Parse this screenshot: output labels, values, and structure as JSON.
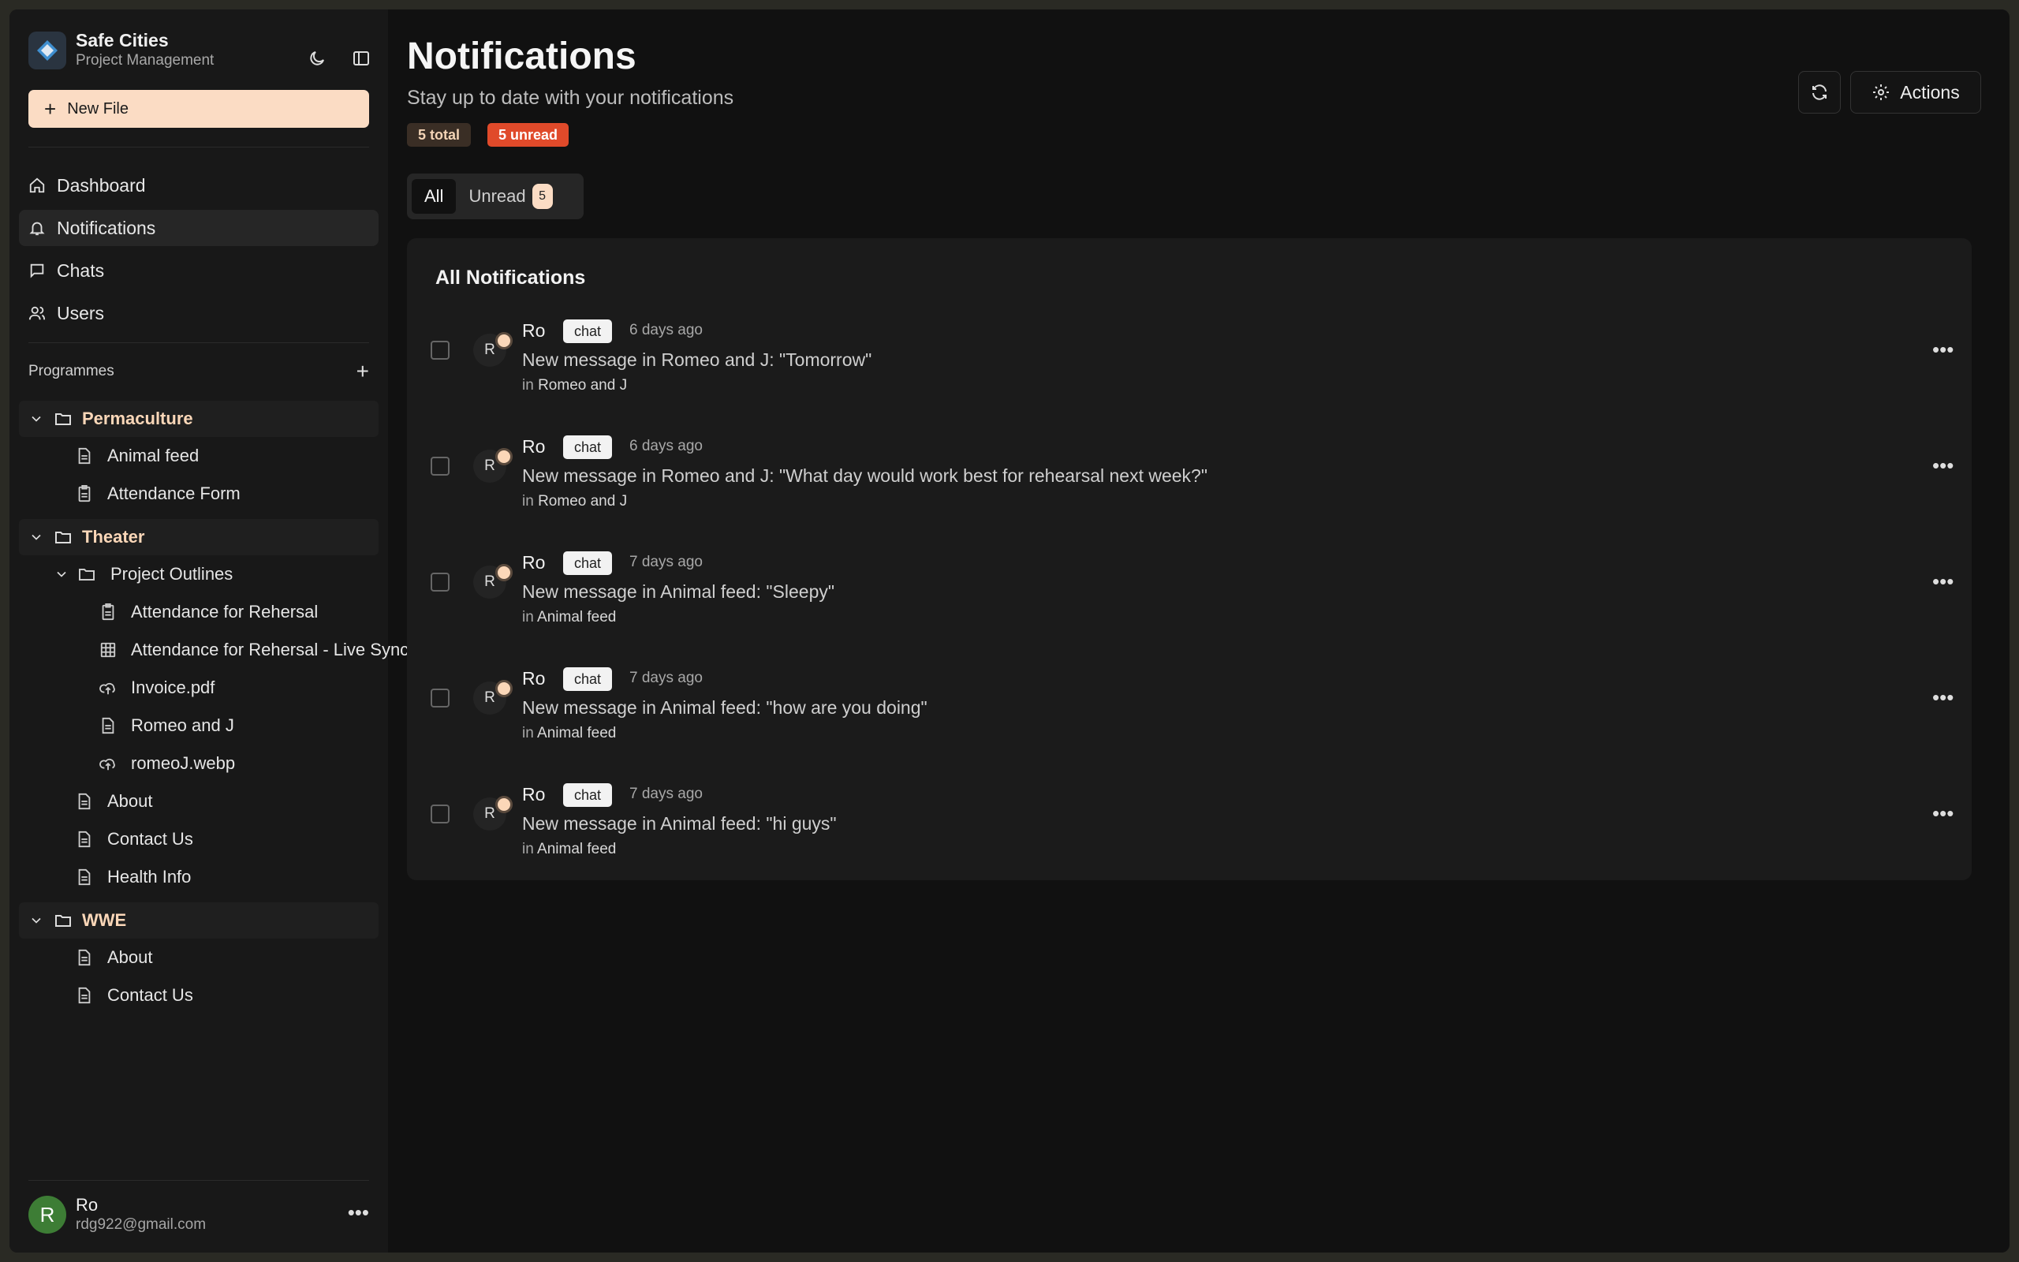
{
  "brand": {
    "title": "Safe Cities",
    "subtitle": "Project Management"
  },
  "sidebar": {
    "new_file": "New File",
    "nav": [
      {
        "label": "Dashboard",
        "icon": "home-icon"
      },
      {
        "label": "Notifications",
        "icon": "bell-icon",
        "active": true
      },
      {
        "label": "Chats",
        "icon": "chat-icon"
      },
      {
        "label": "Users",
        "icon": "users-icon"
      }
    ],
    "programmes_title": "Programmes",
    "tree": {
      "permaculture": {
        "name": "Permaculture",
        "items": [
          "Animal feed",
          "Attendance Form"
        ]
      },
      "theater": {
        "name": "Theater",
        "project_outlines": {
          "name": "Project Outlines",
          "items": [
            "Attendance for Rehersal",
            "Attendance for Rehersal - Live Sync",
            "Invoice.pdf",
            "Romeo and J",
            "romeoJ.webp"
          ]
        },
        "items": [
          "About",
          "Contact Us",
          "Health Info"
        ]
      },
      "wwe": {
        "name": "WWE",
        "items": [
          "About",
          "Contact Us"
        ]
      }
    },
    "user": {
      "initial": "R",
      "name": "Ro",
      "email": "rdg922@gmail.com"
    }
  },
  "main": {
    "title": "Notifications",
    "subtitle": "Stay up to date with your notifications",
    "badges": {
      "total": "5 total",
      "unread": "5 unread"
    },
    "actions_label": "Actions",
    "tabs": {
      "all": "All",
      "unread": "Unread",
      "unread_count": "5"
    },
    "card_title": "All Notifications",
    "notifications": [
      {
        "initial": "R",
        "author": "Ro",
        "tag": "chat",
        "time": "6 days ago",
        "message": "New message in Romeo and J: \"Tomorrow\"",
        "in_prefix": "in",
        "location": "Romeo and J"
      },
      {
        "initial": "R",
        "author": "Ro",
        "tag": "chat",
        "time": "6 days ago",
        "message": "New message in Romeo and J: \"What day would work best for rehearsal next week?\"",
        "in_prefix": "in",
        "location": "Romeo and J"
      },
      {
        "initial": "R",
        "author": "Ro",
        "tag": "chat",
        "time": "7 days ago",
        "message": "New message in Animal feed: \"Sleepy\"",
        "in_prefix": "in",
        "location": "Animal feed"
      },
      {
        "initial": "R",
        "author": "Ro",
        "tag": "chat",
        "time": "7 days ago",
        "message": "New message in Animal feed: \"how are you doing\"",
        "in_prefix": "in",
        "location": "Animal feed"
      },
      {
        "initial": "R",
        "author": "Ro",
        "tag": "chat",
        "time": "7 days ago",
        "message": "New message in Animal feed: \"hi guys\"",
        "in_prefix": "in",
        "location": "Animal feed"
      }
    ]
  },
  "colors": {
    "accent": "#fbdcc4",
    "folder_text": "#fbd7b8",
    "unread_badge": "#e04a2a",
    "avatar_green": "#3d7d35"
  }
}
